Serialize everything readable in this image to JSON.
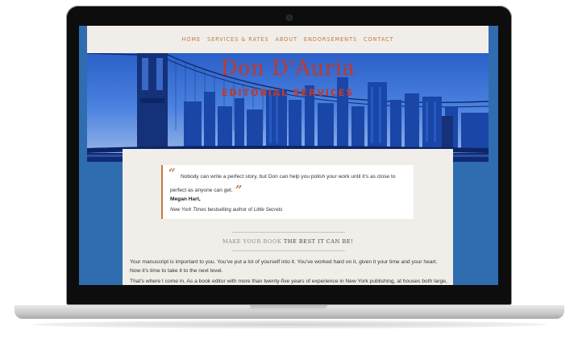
{
  "nav": {
    "items": [
      "HOME",
      "SERVICES & RATES",
      "ABOUT",
      "ENDORSEMENTS",
      "CONTACT"
    ]
  },
  "hero": {
    "title": "Don D'Auria",
    "subtitle": "EDITORIAL SERVICES"
  },
  "testimonial": {
    "open_mark": "“",
    "close_mark": "”",
    "quote": "Nobody can write a perfect story, but Don can help you polish your work until it's as close to perfect as anyone can get.",
    "author": "Megan Hart,",
    "credit_prefix": "New York Times",
    "credit_middle": " bestselling author of ",
    "credit_book": "Little Secrets"
  },
  "tagline": {
    "part1": "MAKE YOUR BOOK",
    "part2": "THE BEST IT CAN BE!"
  },
  "body": {
    "paragraph1": "Your manuscript is important to you. You've put a lot of yourself into it. You've worked hard on it, given it your time and your heart. Now it's time to take it to the next level.",
    "paragraph2": "That's where I come in. As a book editor with more than twenty-five years of experience in New York publishing, at houses both large,"
  },
  "colors": {
    "accent": "#c27b3e",
    "brand_red": "#c0392b",
    "page_bg": "#f1eeea",
    "site_blue": "#2f6db0"
  }
}
